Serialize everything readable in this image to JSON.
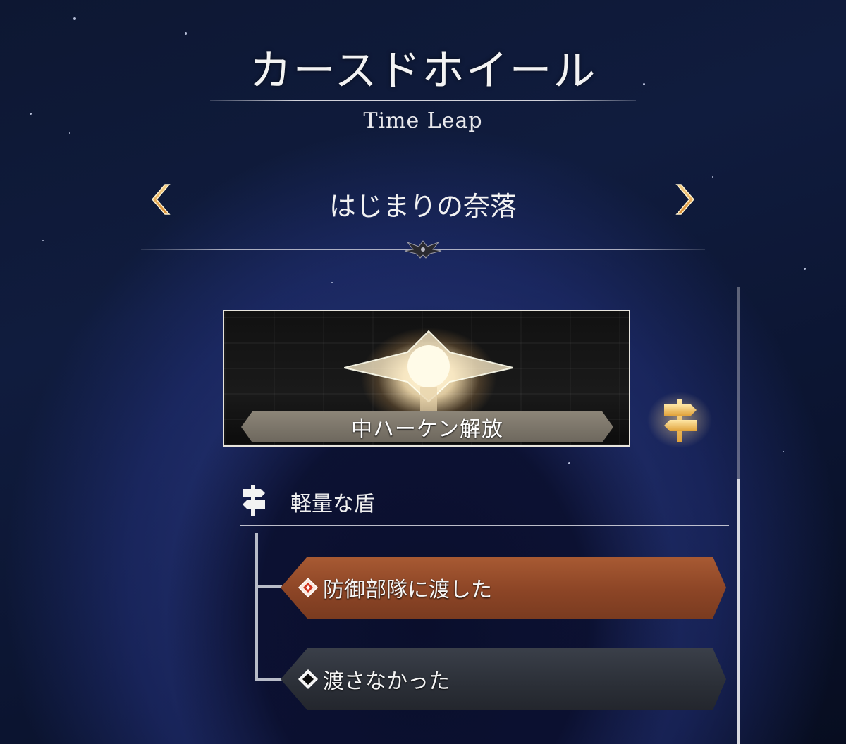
{
  "header": {
    "title": "カースドホイール",
    "subtitle": "Time Leap"
  },
  "chapter": {
    "name": "はじまりの奈落",
    "prev_icon": "chevron-left-icon",
    "next_icon": "chevron-right-icon"
  },
  "event": {
    "label": "中ハーケン解放",
    "signpost_icon": "signpost-icon"
  },
  "branch": {
    "title": "軽量な盾",
    "icon": "signpost-icon",
    "choices": [
      {
        "text": "防御部隊に渡した",
        "selected": true
      },
      {
        "text": "渡さなかった",
        "selected": false
      }
    ]
  },
  "colors": {
    "accent_gold": "#e8b04a",
    "selected_choice": "#8c4526",
    "unselected_choice": "#2b2f37"
  }
}
